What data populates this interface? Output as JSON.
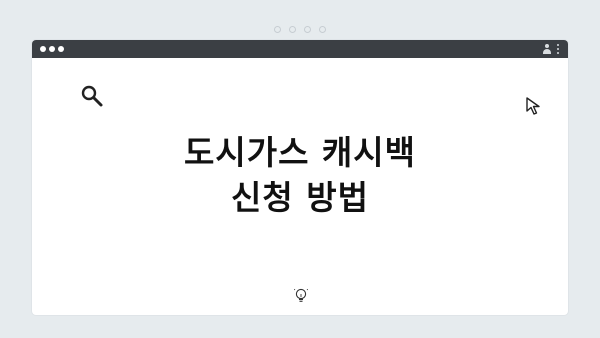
{
  "window": {
    "title_line1": "도시가스 캐시백",
    "title_line2": "신청 방법"
  },
  "icons": {
    "search": "search-icon",
    "cursor": "cursor-pointer-icon",
    "bulb": "lightbulb-icon",
    "user": "user-icon",
    "menu": "kebab-menu-icon"
  },
  "colors": {
    "titlebar": "#3b3f44",
    "background": "#e6ebee",
    "window": "#ffffff",
    "text": "#111111"
  }
}
